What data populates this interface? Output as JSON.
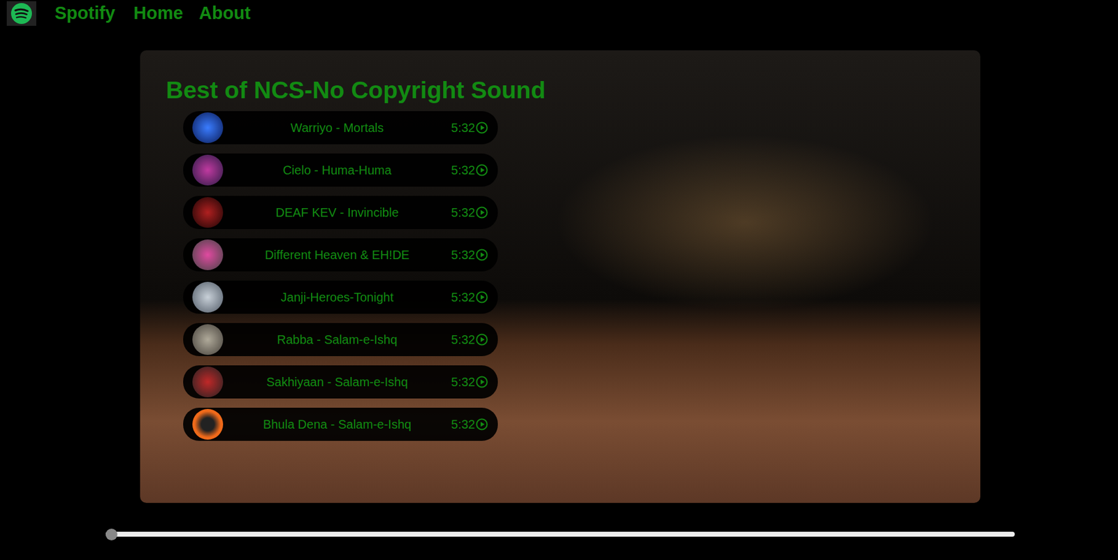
{
  "nav": {
    "brand": "Spotify",
    "links": [
      "Home",
      "About"
    ]
  },
  "playlist": {
    "title": "Best of NCS-No Copyright Sound",
    "songs": [
      {
        "title": "Warriyo - Mortals",
        "duration": "5:32"
      },
      {
        "title": "Cielo - Huma-Huma",
        "duration": "5:32"
      },
      {
        "title": "DEAF KEV - Invincible",
        "duration": "5:32"
      },
      {
        "title": "Different Heaven & EH!DE",
        "duration": "5:32"
      },
      {
        "title": "Janji-Heroes-Tonight",
        "duration": "5:32"
      },
      {
        "title": "Rabba - Salam-e-Ishq",
        "duration": "5:32"
      },
      {
        "title": "Sakhiyaan - Salam-e-Ishq",
        "duration": "5:32"
      },
      {
        "title": "Bhula Dena - Salam-e-Ishq",
        "duration": "5:32"
      }
    ]
  },
  "progress": {
    "level": 0
  }
}
